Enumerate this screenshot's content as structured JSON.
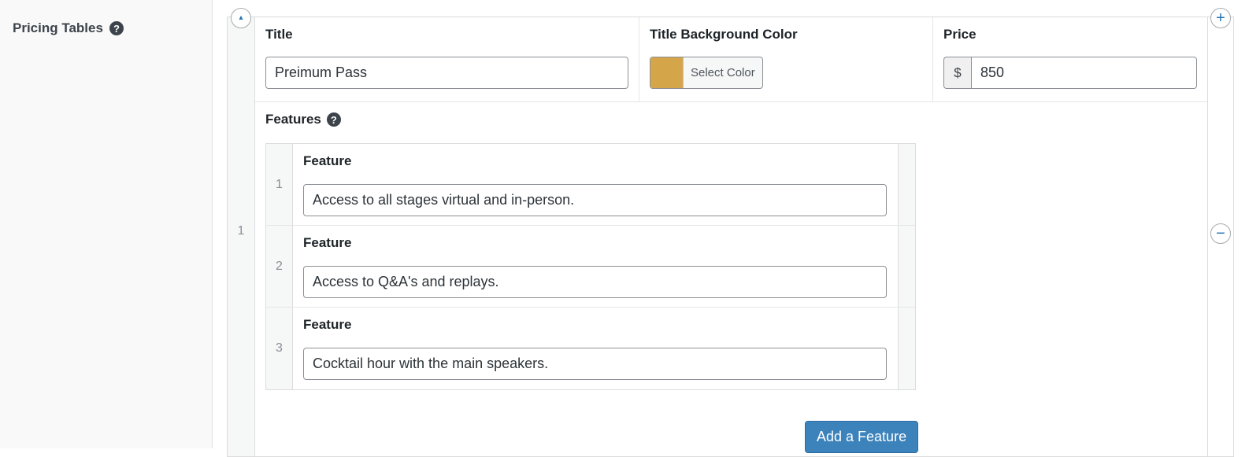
{
  "field": {
    "label": "Pricing Tables",
    "help_glyph": "?"
  },
  "repeater": {
    "row_number": "1",
    "collapse_glyph": "▴",
    "add_glyph": "+",
    "remove_glyph": "−",
    "columns": {
      "title_label": "Title",
      "color_label": "Title Background Color",
      "price_label": "Price"
    },
    "title_value": "Preimum Pass",
    "color": {
      "button_label": "Select Color",
      "value": "#d5a54a"
    },
    "price": {
      "currency": "$",
      "value": "850"
    },
    "features": {
      "label": "Features",
      "help_glyph": "?",
      "items": [
        {
          "order": "1",
          "label": "Feature",
          "value": "Access to all stages virtual and in-person."
        },
        {
          "order": "2",
          "label": "Feature",
          "value": "Access to Q&A's and replays."
        },
        {
          "order": "3",
          "label": "Feature",
          "value": "Cocktail hour with the main speakers."
        }
      ],
      "add_button_label": "Add a Feature"
    }
  }
}
